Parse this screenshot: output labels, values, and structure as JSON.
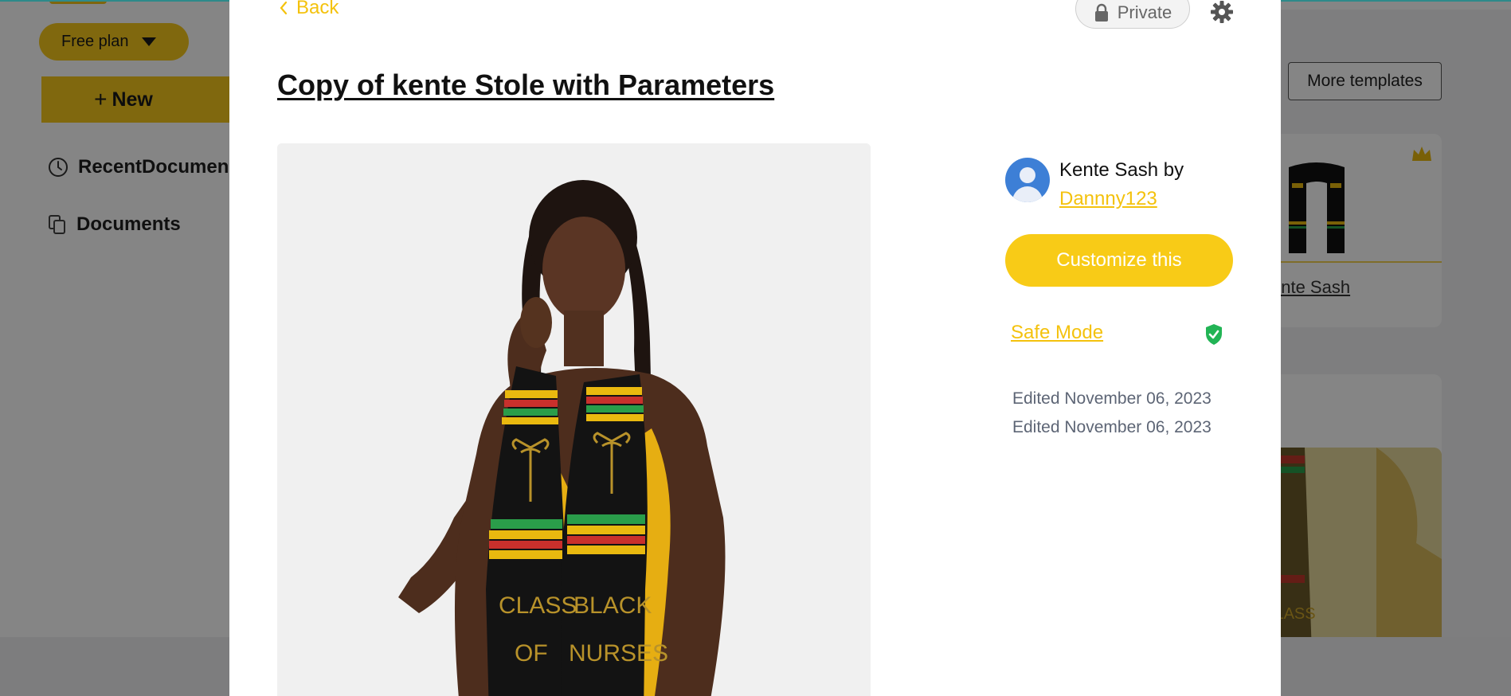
{
  "background": {
    "plan_label": "Free plan",
    "new_button": "New",
    "nav": [
      {
        "label": "RecentDocumen",
        "icon": "clock-icon"
      },
      {
        "label": "Documents",
        "icon": "documents-icon"
      }
    ],
    "more_templates": "More templates",
    "template_card_label": "ente Sash"
  },
  "modal": {
    "back_label": "Back",
    "privacy_label": "Private",
    "title": "Copy of kente Stole with Parameters",
    "preview_image": {
      "stole_left_text": [
        "CLASS",
        "OF"
      ],
      "stole_right_text": [
        "BLACK",
        "NURSES"
      ]
    },
    "author_prefix": "Kente Sash by",
    "author_name": "Dannny123",
    "customize_label": "Customize this",
    "safe_mode_label": "Safe Mode",
    "edited_lines": [
      "Edited November 06, 2023",
      "Edited November 06, 2023"
    ]
  },
  "colors": {
    "accent": "#f8cb17",
    "link": "#f4c20d",
    "shield": "#22b455",
    "avatar": "#3d7fd6",
    "overlay": "rgba(0,0,0,0.48)"
  }
}
